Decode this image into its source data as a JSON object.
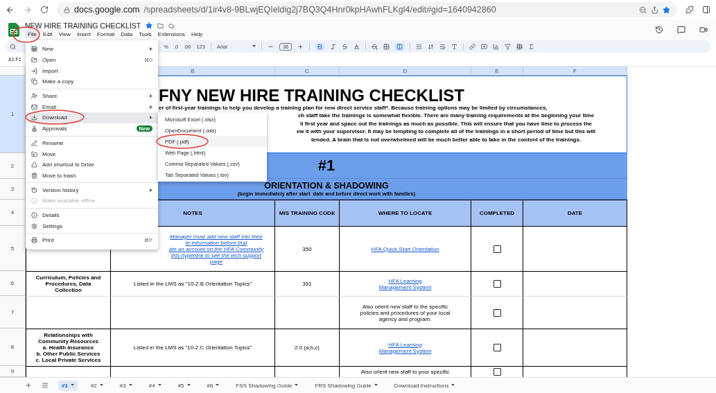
{
  "browser": {
    "url_host": "docs.google.com",
    "url_path": "/spreadsheets/d/1ir4v8-9BLwjEQIeldig2j7BQ3Q4Hnr0kpHAwhFLKgl4/edit#gid=1640942860",
    "bookmarked": true
  },
  "doc": {
    "title": "NEW HIRE TRAINING CHECKLIST",
    "starred": true
  },
  "menubar": [
    {
      "label": "File",
      "selected": true
    },
    {
      "label": "Edit",
      "selected": false
    },
    {
      "label": "View",
      "selected": false
    },
    {
      "label": "Insert",
      "selected": false
    },
    {
      "label": "Format",
      "selected": false
    },
    {
      "label": "Data",
      "selected": false
    },
    {
      "label": "Tools",
      "selected": false
    },
    {
      "label": "Extensions",
      "selected": false
    },
    {
      "label": "Help",
      "selected": false
    }
  ],
  "toolbar": {
    "percent": "%",
    "decrease_decimals": ".0",
    "increase_decimals": ".00",
    "number_format": "123",
    "font": "Arial",
    "font_size": "36"
  },
  "name_box": "A1:F1",
  "columns": [
    {
      "label": "B",
      "selected": true
    },
    {
      "label": "C",
      "selected": true
    },
    {
      "label": "D",
      "selected": true
    },
    {
      "label": "E",
      "selected": true
    },
    {
      "label": "F",
      "selected": true
    }
  ],
  "row_numbers": [
    {
      "label": "1",
      "selected": true
    },
    {
      "label": "2",
      "selected": false
    },
    {
      "label": "3",
      "selected": false
    },
    {
      "label": "4",
      "selected": false
    },
    {
      "label": "5",
      "selected": false
    },
    {
      "label": "6",
      "selected": false
    },
    {
      "label": "7",
      "selected": false
    },
    {
      "label": "8",
      "selected": false
    },
    {
      "label": "9",
      "selected": false
    }
  ],
  "sheet": {
    "title": "FNY NEW HIRE TRAINING CHECKLIST",
    "description": [
      "er of first-year trainings to help you develop a training plan for new direct service staff*. Because training options may be limited by circumstances,",
      "ch staff take the trainings is somewhat flexible. There are many training requirements at the beginning your time",
      "ll first year and space out the trainings as much as possible. This will ensure that you have time to process the",
      "ew it with your supervisor. It may be tempting to complete all of the trainings in a short period of time but this will",
      "tended. A brain that is not overwhelmed will be much better able to take in the content of the trainings."
    ],
    "band_number": "#1",
    "band_title": "ORIENTATION & SHADOWING",
    "band_subtitle": "(begin immediately after start  date and before direct work with families)",
    "headers": [
      "NOTES",
      "MIS TRAINING CODE",
      "WHERE TO LOCATE",
      "COMPLETED",
      "DATE"
    ],
    "rows": [
      {
        "notes": {
          "kind": "link",
          "lines": [
            "Manager must add new staff into their",
            "te information before that",
            "ate an account on the HFA Community",
            "this hyperlink to see the tech support",
            "page"
          ]
        },
        "code": "350",
        "locate": {
          "kind": "link",
          "lines": [
            "HFA Quick Start Orientation"
          ]
        },
        "completed": false
      },
      {
        "topic": [
          "Curriculum, Policies and",
          "Procedures, Data",
          "Collection"
        ],
        "notes": {
          "kind": "text",
          "lines": [
            "Listed in the LMS as \"10-2.B Orientation Topics\""
          ]
        },
        "code": "351",
        "locate": {
          "kind": "link",
          "lines": [
            "HFA Learning",
            "Management System"
          ]
        },
        "completed": false
      },
      {
        "locate": {
          "kind": "text",
          "lines": [
            "Also orient new staff to the specific",
            "policies and procedures of your local",
            "agency and program."
          ]
        },
        "completed": false
      },
      {
        "topic": [
          "Relationships with",
          "Community Resources",
          "a. Health Insurance",
          "b. Other Public Services",
          "c. Local Private Services"
        ],
        "notes": {
          "kind": "text",
          "lines": [
            "Listed in the LMS as \"10-2.C Orientation Topics\""
          ]
        },
        "code": "2.0 (a,b,c)",
        "locate": {
          "kind": "link",
          "lines": [
            "HFA Learning",
            "Management System"
          ]
        },
        "completed": false
      },
      {
        "locate": {
          "kind": "text",
          "lines": [
            "Also orient new staff to your specific"
          ]
        },
        "completed": false
      }
    ]
  },
  "file_menu": [
    [
      {
        "label": "New",
        "submenu": true,
        "selected": false,
        "disabled": false
      },
      {
        "label": "Open",
        "shortcut": "⌘O",
        "submenu": false,
        "selected": false,
        "disabled": false
      },
      {
        "label": "Import",
        "submenu": false,
        "selected": false,
        "disabled": false
      },
      {
        "label": "Make a copy",
        "submenu": false,
        "selected": false,
        "disabled": false
      }
    ],
    [
      {
        "label": "Share",
        "submenu": true,
        "selected": false,
        "disabled": false
      },
      {
        "label": "Email",
        "submenu": true,
        "selected": false,
        "disabled": false
      },
      {
        "label": "Download",
        "submenu": true,
        "selected": true,
        "disabled": false
      },
      {
        "label": "Approvals",
        "badge": "New",
        "submenu": false,
        "selected": false,
        "disabled": false
      }
    ],
    [
      {
        "label": "Rename",
        "submenu": false,
        "selected": false,
        "disabled": false
      },
      {
        "label": "Move",
        "submenu": false,
        "selected": false,
        "disabled": false
      },
      {
        "label": "Add shortcut to Drive",
        "submenu": false,
        "selected": false,
        "disabled": false
      },
      {
        "label": "Move to trash",
        "submenu": false,
        "selected": false,
        "disabled": false
      }
    ],
    [
      {
        "label": "Version history",
        "submenu": true,
        "selected": false,
        "disabled": false
      },
      {
        "label": "Make available offline",
        "submenu": false,
        "selected": false,
        "disabled": true
      }
    ],
    [
      {
        "label": "Details",
        "submenu": false,
        "selected": false,
        "disabled": false
      },
      {
        "label": "Settings",
        "submenu": false,
        "selected": false,
        "disabled": false
      }
    ],
    [
      {
        "label": "Print",
        "shortcut": "⌘P",
        "submenu": false,
        "selected": false,
        "disabled": false
      }
    ]
  ],
  "download_menu": [
    {
      "label": "Microsoft Excel (.xlsx)",
      "selected": false
    },
    {
      "label": "OpenDocument (.ods)",
      "selected": false
    },
    {
      "label": "PDF (.pdf)",
      "selected": true
    },
    {
      "label": "Web Page (.html)",
      "selected": false
    },
    {
      "label": "Comma Separated Values (.csv)",
      "selected": false
    },
    {
      "label": "Tab Separated Values (.tsv)",
      "selected": false
    }
  ],
  "sheet_tabs": [
    {
      "label": "#1",
      "selected": true
    },
    {
      "label": "#2",
      "selected": false
    },
    {
      "label": "#3",
      "selected": false
    },
    {
      "label": "#4",
      "selected": false
    },
    {
      "label": "#5",
      "selected": false
    },
    {
      "label": "#6",
      "selected": false
    },
    {
      "label": "FSS Shadowing Guide",
      "selected": false
    },
    {
      "label": "FRS Shadowing Guide",
      "selected": false
    },
    {
      "label": "Download Instructions",
      "selected": false
    }
  ]
}
